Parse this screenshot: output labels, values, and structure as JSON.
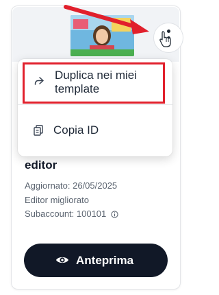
{
  "menu": {
    "duplicate_label_line1": "Duplica nei miei",
    "duplicate_label_line2": "template",
    "copy_id_label": "Copia ID"
  },
  "card": {
    "title": "editor",
    "updated": "Aggiornato: 26/05/2025",
    "editor_type": "Editor migliorato",
    "subaccount": "Subaccount: 100101",
    "preview_label": "Anteprima"
  },
  "colors": {
    "annotation_red": "#e1202c",
    "button_dark": "#111827"
  },
  "icons": [
    "more-vertical-icon",
    "pointer-cursor-icon",
    "share-forward-icon",
    "copy-icon",
    "info-icon",
    "eye-icon"
  ]
}
